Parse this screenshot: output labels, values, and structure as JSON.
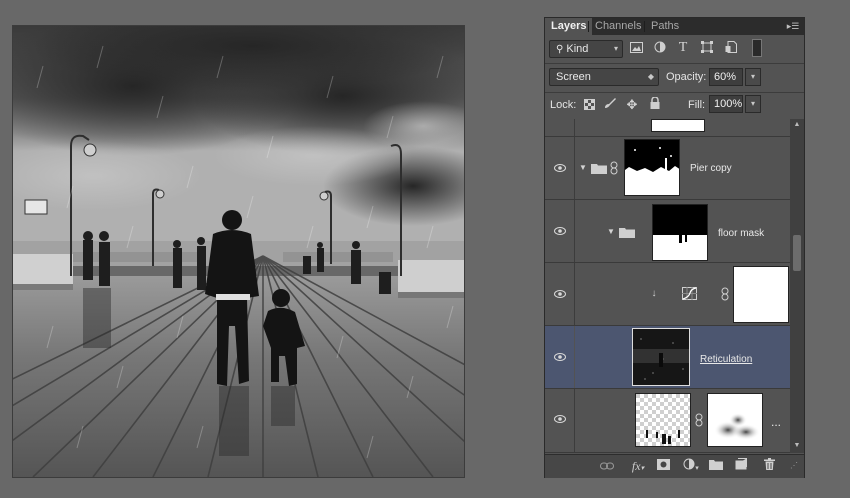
{
  "panel": {
    "tabs": [
      {
        "label": "Layers",
        "active": true
      },
      {
        "label": "Channels",
        "active": false
      },
      {
        "label": "Paths",
        "active": false
      }
    ],
    "filter_kind": "Kind",
    "blend_mode": "Screen",
    "opacity_label": "Opacity:",
    "opacity_value": "60%",
    "lock_label": "Lock:",
    "fill_label": "Fill:",
    "fill_value": "100%",
    "layers": [
      {
        "name": "",
        "type": "mask-partial"
      },
      {
        "name": "Pier copy",
        "type": "group",
        "expanded": true
      },
      {
        "name": "floor mask",
        "type": "group",
        "expanded": true
      },
      {
        "name": "",
        "type": "adjustment-curves",
        "clipped": true
      },
      {
        "name": "Reticulation ",
        "type": "image",
        "selected": true
      },
      {
        "name": "",
        "type": "image-with-mask",
        "more": "..."
      }
    ],
    "bottom_icons": [
      "link-icon",
      "fx-icon",
      "add-mask-icon",
      "adjustment-icon",
      "new-group-icon",
      "new-layer-icon",
      "trash-icon"
    ],
    "fx_label": "fx"
  },
  "canvas": {
    "description_icon": "photo-rainy-pier"
  }
}
